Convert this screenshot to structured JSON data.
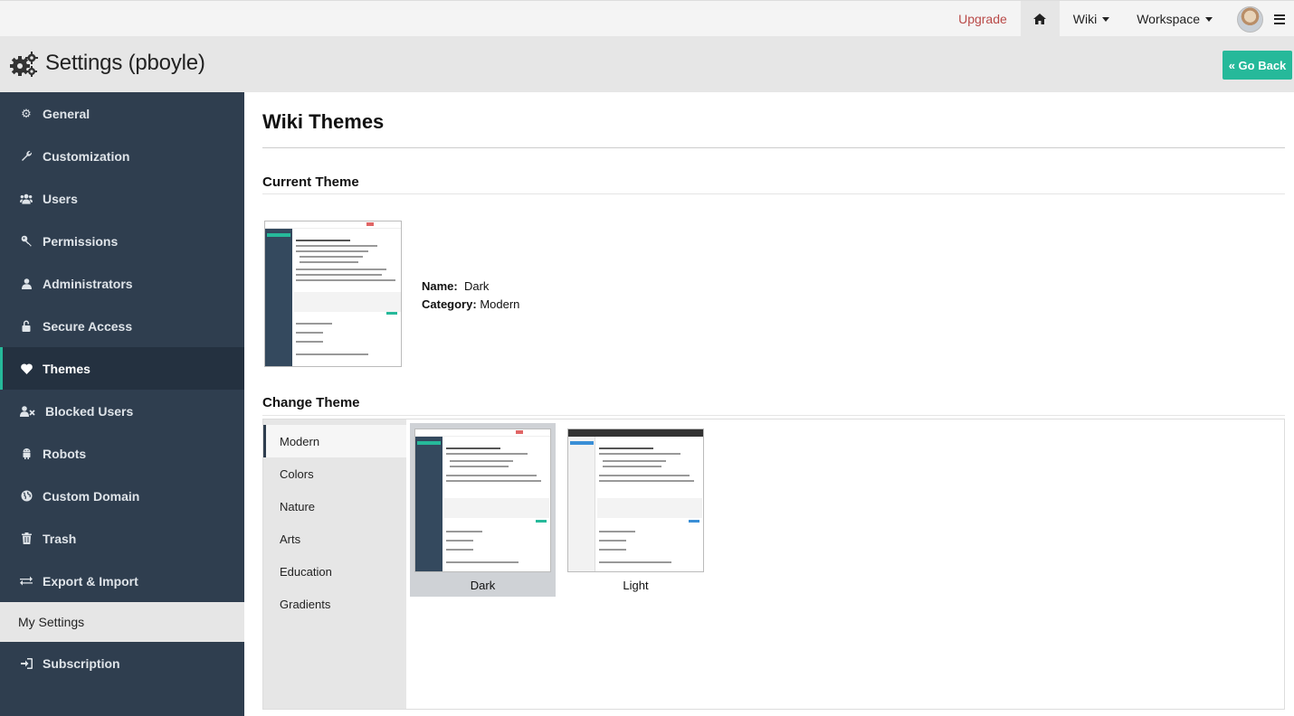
{
  "topbar": {
    "upgrade": "Upgrade",
    "wiki": "Wiki",
    "workspace": "Workspace"
  },
  "header": {
    "title": "Settings (pboyle)",
    "go_back": "« Go Back"
  },
  "sidebar": {
    "items": [
      {
        "label": "General",
        "icon": "gear-icon"
      },
      {
        "label": "Customization",
        "icon": "wrench-icon"
      },
      {
        "label": "Users",
        "icon": "users-icon"
      },
      {
        "label": "Permissions",
        "icon": "key-icon"
      },
      {
        "label": "Administrators",
        "icon": "user-icon"
      },
      {
        "label": "Secure Access",
        "icon": "lock-icon"
      },
      {
        "label": "Themes",
        "icon": "heart-icon",
        "active": true
      },
      {
        "label": "Blocked Users",
        "icon": "user-times-icon"
      },
      {
        "label": "Robots",
        "icon": "android-icon"
      },
      {
        "label": "Custom Domain",
        "icon": "globe-icon"
      },
      {
        "label": "Trash",
        "icon": "trash-icon"
      },
      {
        "label": "Export & Import",
        "icon": "exchange-icon"
      }
    ],
    "my_settings": "My Settings",
    "subscription": "Subscription"
  },
  "main": {
    "title": "Wiki Themes",
    "current_heading": "Current Theme",
    "current": {
      "name_label": "Name:",
      "name": "Dark",
      "category_label": "Category:",
      "category": "Modern"
    },
    "change_heading": "Change Theme",
    "categories": [
      "Modern",
      "Colors",
      "Nature",
      "Arts",
      "Education",
      "Gradients"
    ],
    "active_category": "Modern",
    "themes": [
      {
        "label": "Dark",
        "selected": true
      },
      {
        "label": "Light",
        "selected": false
      }
    ]
  },
  "colors": {
    "accent": "#26b99a",
    "sidebar": "#2f3e4f",
    "upgrade": "#b94a48"
  }
}
